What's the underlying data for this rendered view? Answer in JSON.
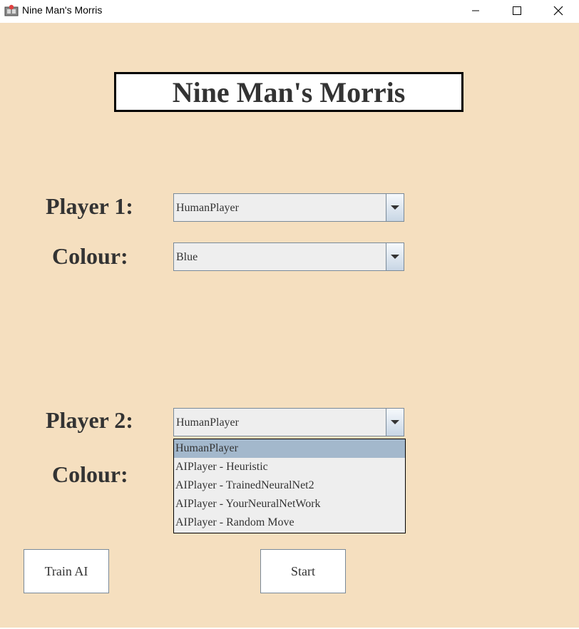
{
  "window": {
    "title": "Nine Man's Morris",
    "minimize_icon": "minimize-icon",
    "maximize_icon": "maximize-icon",
    "close_icon": "close-icon"
  },
  "heading": "Nine Man's Morris",
  "player1": {
    "label": "Player 1:",
    "type_value": "HumanPlayer",
    "colour_label": "Colour:",
    "colour_value": "Blue"
  },
  "player2": {
    "label": "Player 2:",
    "type_value": "HumanPlayer",
    "colour_label": "Colour:"
  },
  "dropdown": {
    "options": [
      "HumanPlayer",
      "AIPlayer - Heuristic",
      "AIPlayer - TrainedNeuralNet2",
      "AIPlayer - YourNeuralNetWork",
      "AIPlayer - Random Move"
    ],
    "selected_index": 0
  },
  "buttons": {
    "train": "Train AI",
    "start": "Start"
  },
  "colors": {
    "background": "#f5dfbf",
    "selection": "#a3b8cc",
    "text": "#333333"
  }
}
